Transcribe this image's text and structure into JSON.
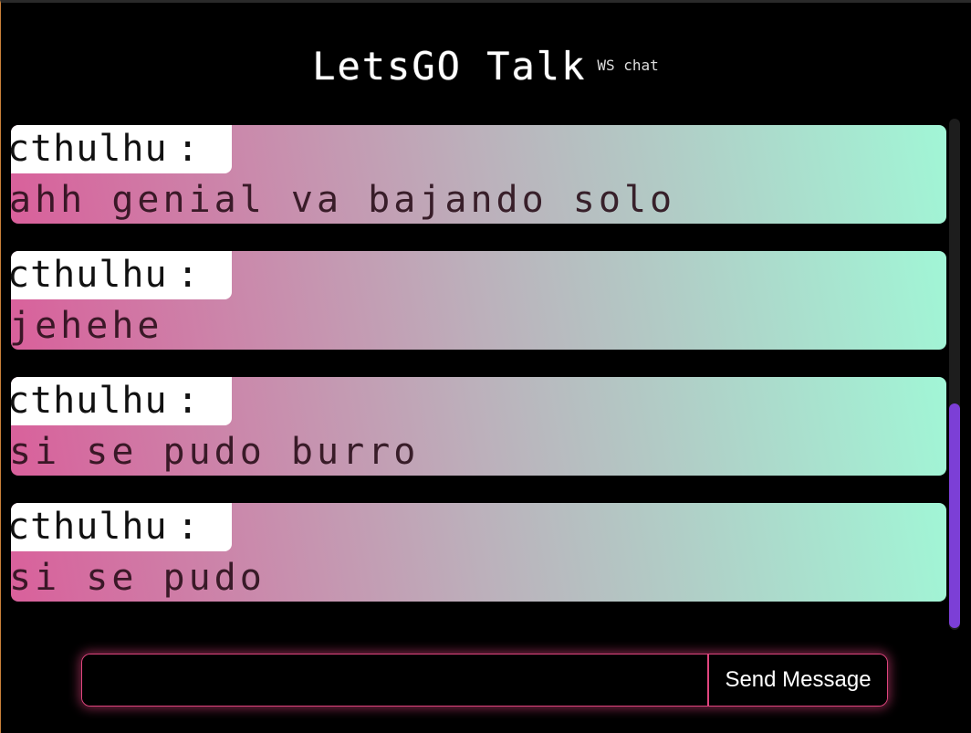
{
  "header": {
    "title": "LetsGO Talk",
    "subtitle": "WS chat"
  },
  "messages": [
    {
      "author": "cthulhu",
      "separator": ":",
      "text": "ahh genial va bajando solo"
    },
    {
      "author": "cthulhu",
      "separator": ":",
      "text": "jehehe"
    },
    {
      "author": "cthulhu",
      "separator": ":",
      "text": "si se pudo burro"
    },
    {
      "author": "cthulhu",
      "separator": ":",
      "text": "si se pudo"
    }
  ],
  "composer": {
    "value": "",
    "placeholder": "",
    "send_label": "Send Message"
  },
  "colors": {
    "gradient_start": "#d9609b",
    "gradient_mid": "#bcb0bb",
    "gradient_end": "#a1f6d6",
    "accent_border": "#e0457e",
    "scrollbar_thumb": "#7c3fd6"
  }
}
